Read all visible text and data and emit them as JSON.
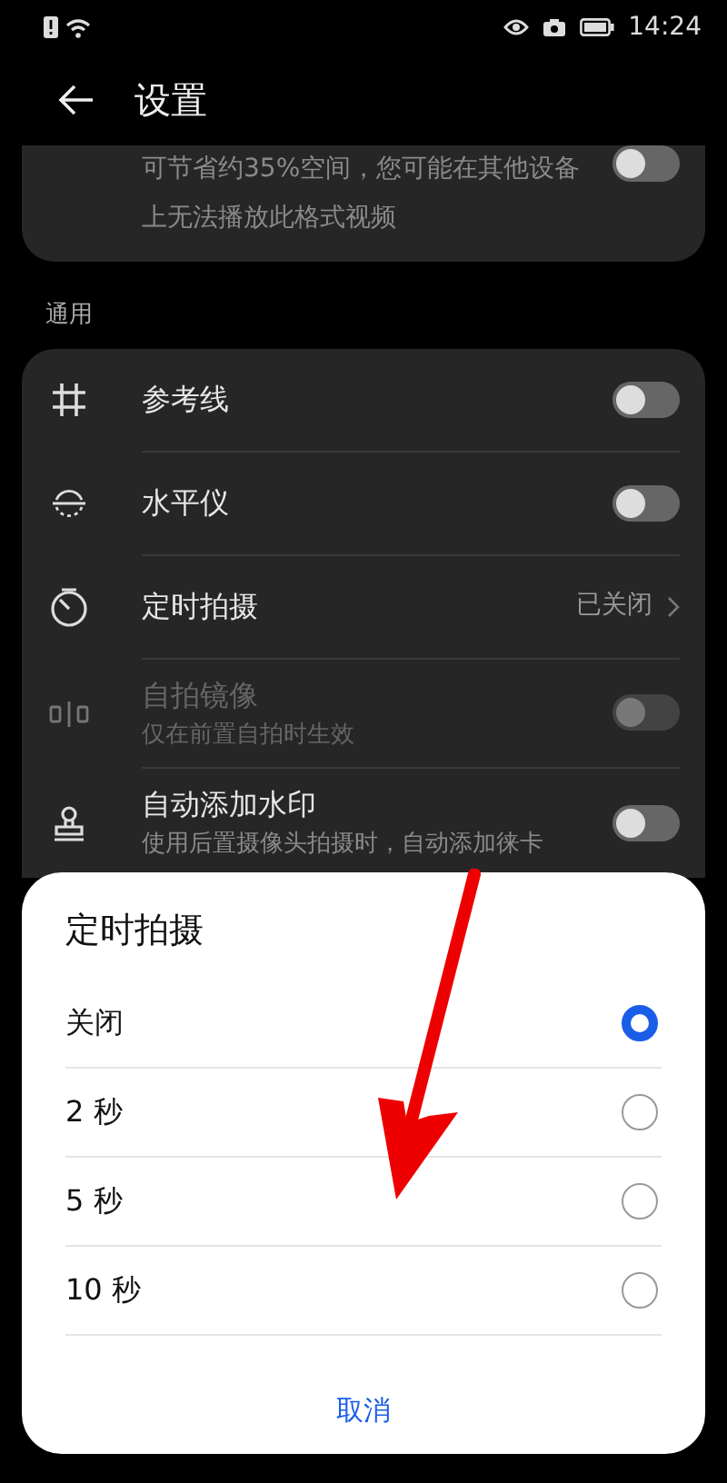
{
  "status_bar": {
    "time": "14:24"
  },
  "header": {
    "title": "设置"
  },
  "top_card": {
    "description": "可节省约35%空间，您可能在其他设备上无法播放此格式视频",
    "on": false
  },
  "section": {
    "title": "通用",
    "items": [
      {
        "kind": "toggle",
        "label": "参考线",
        "on": false,
        "disabled": false
      },
      {
        "kind": "toggle",
        "label": "水平仪",
        "on": false,
        "disabled": false
      },
      {
        "kind": "value",
        "label": "定时拍摄",
        "value": "已关闭"
      },
      {
        "kind": "toggle",
        "label": "自拍镜像",
        "subtitle": "仅在前置自拍时生效",
        "on": false,
        "disabled": true
      },
      {
        "kind": "toggle",
        "label": "自动添加水印",
        "subtitle": "使用后置摄像头拍摄时，自动添加徕卡",
        "on": false,
        "disabled": false
      }
    ]
  },
  "dialog": {
    "title": "定时拍摄",
    "options": [
      {
        "label": "关闭",
        "selected": true
      },
      {
        "label": "2 秒",
        "selected": false
      },
      {
        "label": "5 秒",
        "selected": false
      },
      {
        "label": "10 秒",
        "selected": false
      }
    ],
    "cancel": "取消"
  }
}
